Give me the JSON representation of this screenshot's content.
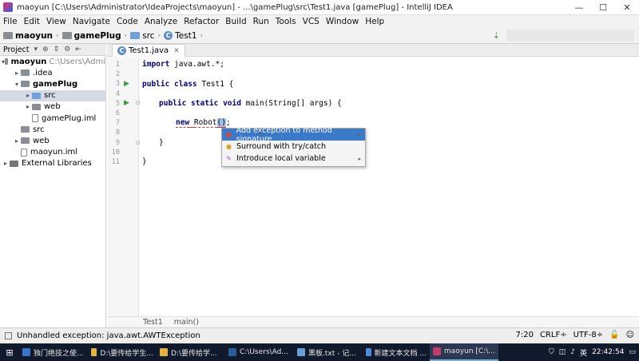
{
  "window": {
    "title": "maoyun [C:\\Users\\Administrator\\IdeaProjects\\maoyun] - ...\\gamePlug\\src\\Test1.java [gamePlug] - IntelliJ IDEA",
    "minimize": "—",
    "maximize": "☐",
    "close": "✕"
  },
  "menu": [
    "File",
    "Edit",
    "View",
    "Navigate",
    "Code",
    "Analyze",
    "Refactor",
    "Build",
    "Run",
    "Tools",
    "VCS",
    "Window",
    "Help"
  ],
  "navbar": {
    "crumbs": [
      "maoyun",
      "gamePlug",
      "src",
      "Test1"
    ]
  },
  "project_panel": {
    "title": "Project",
    "tree": [
      {
        "label": "maoyun",
        "extra": "C:\\Users\\Admi",
        "indent": 0,
        "arrow": "▾",
        "icon": "folder",
        "bold": true
      },
      {
        "label": ".idea",
        "extra": "",
        "indent": 1,
        "arrow": "▸",
        "icon": "folder",
        "bold": false
      },
      {
        "label": "gamePlug",
        "extra": "",
        "indent": 1,
        "arrow": "▾",
        "icon": "folder",
        "bold": true
      },
      {
        "label": "src",
        "extra": "",
        "indent": 2,
        "arrow": "▸",
        "icon": "folder-blue",
        "bold": false,
        "selected": true
      },
      {
        "label": "web",
        "extra": "",
        "indent": 2,
        "arrow": "▸",
        "icon": "folder",
        "bold": false
      },
      {
        "label": "gamePlug.iml",
        "extra": "",
        "indent": 2,
        "arrow": "",
        "icon": "file",
        "bold": false
      },
      {
        "label": "src",
        "extra": "",
        "indent": 1,
        "arrow": "",
        "icon": "folder",
        "bold": false
      },
      {
        "label": "web",
        "extra": "",
        "indent": 1,
        "arrow": "▸",
        "icon": "folder",
        "bold": false
      },
      {
        "label": "maoyun.iml",
        "extra": "",
        "indent": 1,
        "arrow": "",
        "icon": "file",
        "bold": false
      },
      {
        "label": "External Libraries",
        "extra": "",
        "indent": 0,
        "arrow": "▸",
        "icon": "lib",
        "bold": false
      }
    ]
  },
  "editor": {
    "tab_label": "Test1.java",
    "line_numbers": [
      "1",
      "2",
      "3",
      "4",
      "5",
      "6",
      "7",
      "8",
      "9",
      "10",
      "11"
    ],
    "code": {
      "l1_kw": "import",
      "l1_rest": " java.awt.*;",
      "l3_kw": "public class",
      "l3_rest": " Test1 {",
      "l5_kw": "public static void",
      "l5_rest": " main(String[] args) {",
      "l7_kw": "new",
      "l7_ident": "Robot",
      "l7_lp": "(",
      "l7_rp": ")",
      "l7_end": ";",
      "l9": "}",
      "l11": "}"
    }
  },
  "popup": {
    "items": [
      {
        "label": "Add exception to method signature",
        "icon": "error-bulb-icon",
        "active": true,
        "submenu": true
      },
      {
        "label": "Surround with try/catch",
        "icon": "error-bulb-icon",
        "active": false,
        "submenu": false
      },
      {
        "label": "Introduce local variable",
        "icon": "refactor-pen-icon",
        "active": false,
        "submenu": true
      }
    ]
  },
  "breadcrumb_bottom": [
    "Test1",
    "main()"
  ],
  "status": {
    "message": "Unhandled exception: java.awt.AWTException",
    "position": "7:20",
    "line_sep": "CRLF÷",
    "encoding": "UTF-8÷"
  },
  "taskbar": {
    "items": [
      "独门绝技之使...",
      "D:\\要传给学生...",
      "D:\\要传给学...",
      "C:\\Users\\Ad...",
      "黑板.txt - 记...",
      "新建文本文档 ...",
      "maoyun [C:\\..."
    ],
    "clock": "22:42:54",
    "lang": "英"
  }
}
